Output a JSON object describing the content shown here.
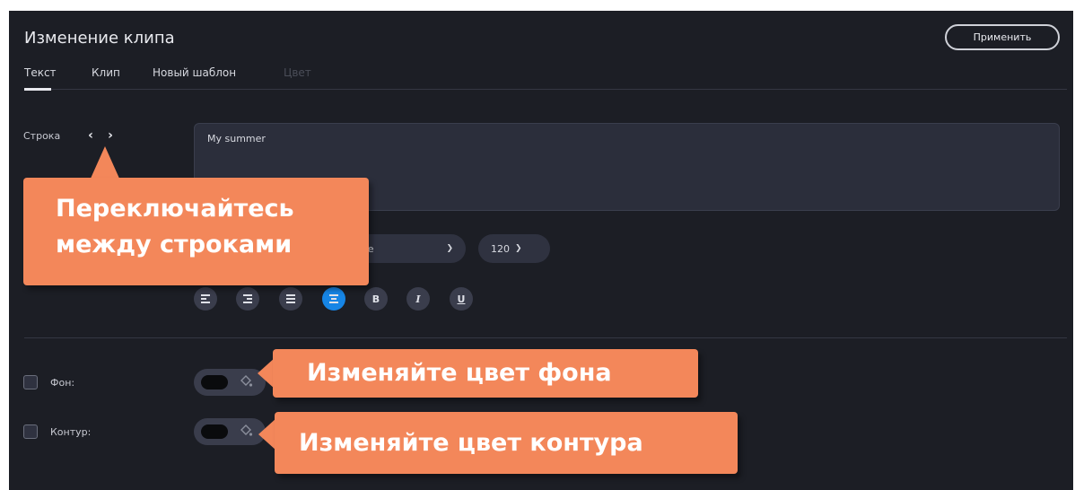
{
  "header": {
    "title": "Изменение клипа",
    "apply_label": "Применить"
  },
  "tabs": [
    {
      "label": "Текст",
      "active": true
    },
    {
      "label": "Клип",
      "active": false
    },
    {
      "label": "Новый шаблон",
      "active": false
    },
    {
      "label": "Цвет",
      "active": false,
      "disabled": true
    }
  ],
  "text_section": {
    "row_label": "Строка",
    "prev_icon": "chevron-left-icon",
    "next_icon": "chevron-right-icon",
    "text_value": "My summer",
    "font_select": {
      "value": "ade"
    },
    "size_select": {
      "value": "120"
    },
    "format_buttons": [
      {
        "name": "align-left-icon"
      },
      {
        "name": "align-right-icon"
      },
      {
        "name": "align-justify-icon"
      },
      {
        "name": "align-center-icon",
        "active": true
      },
      {
        "name": "bold-icon",
        "label": "B"
      },
      {
        "name": "italic-icon",
        "label": "I"
      },
      {
        "name": "underline-icon",
        "label": "U"
      }
    ]
  },
  "options": {
    "background": {
      "label": "Фон:",
      "checked": false,
      "color": "#0a0b0d"
    },
    "outline": {
      "label": "Контур:",
      "checked": false,
      "color": "#0a0b0d"
    }
  },
  "callouts": {
    "rows_line1": "Переключайтесь",
    "rows_line2": "между строками",
    "background": "Изменяйте цвет фона",
    "outline": "Изменяйте цвет контура"
  },
  "colors": {
    "panel_bg": "#1c1e25",
    "accent": "#1685e5",
    "callout": "#f3875a"
  }
}
